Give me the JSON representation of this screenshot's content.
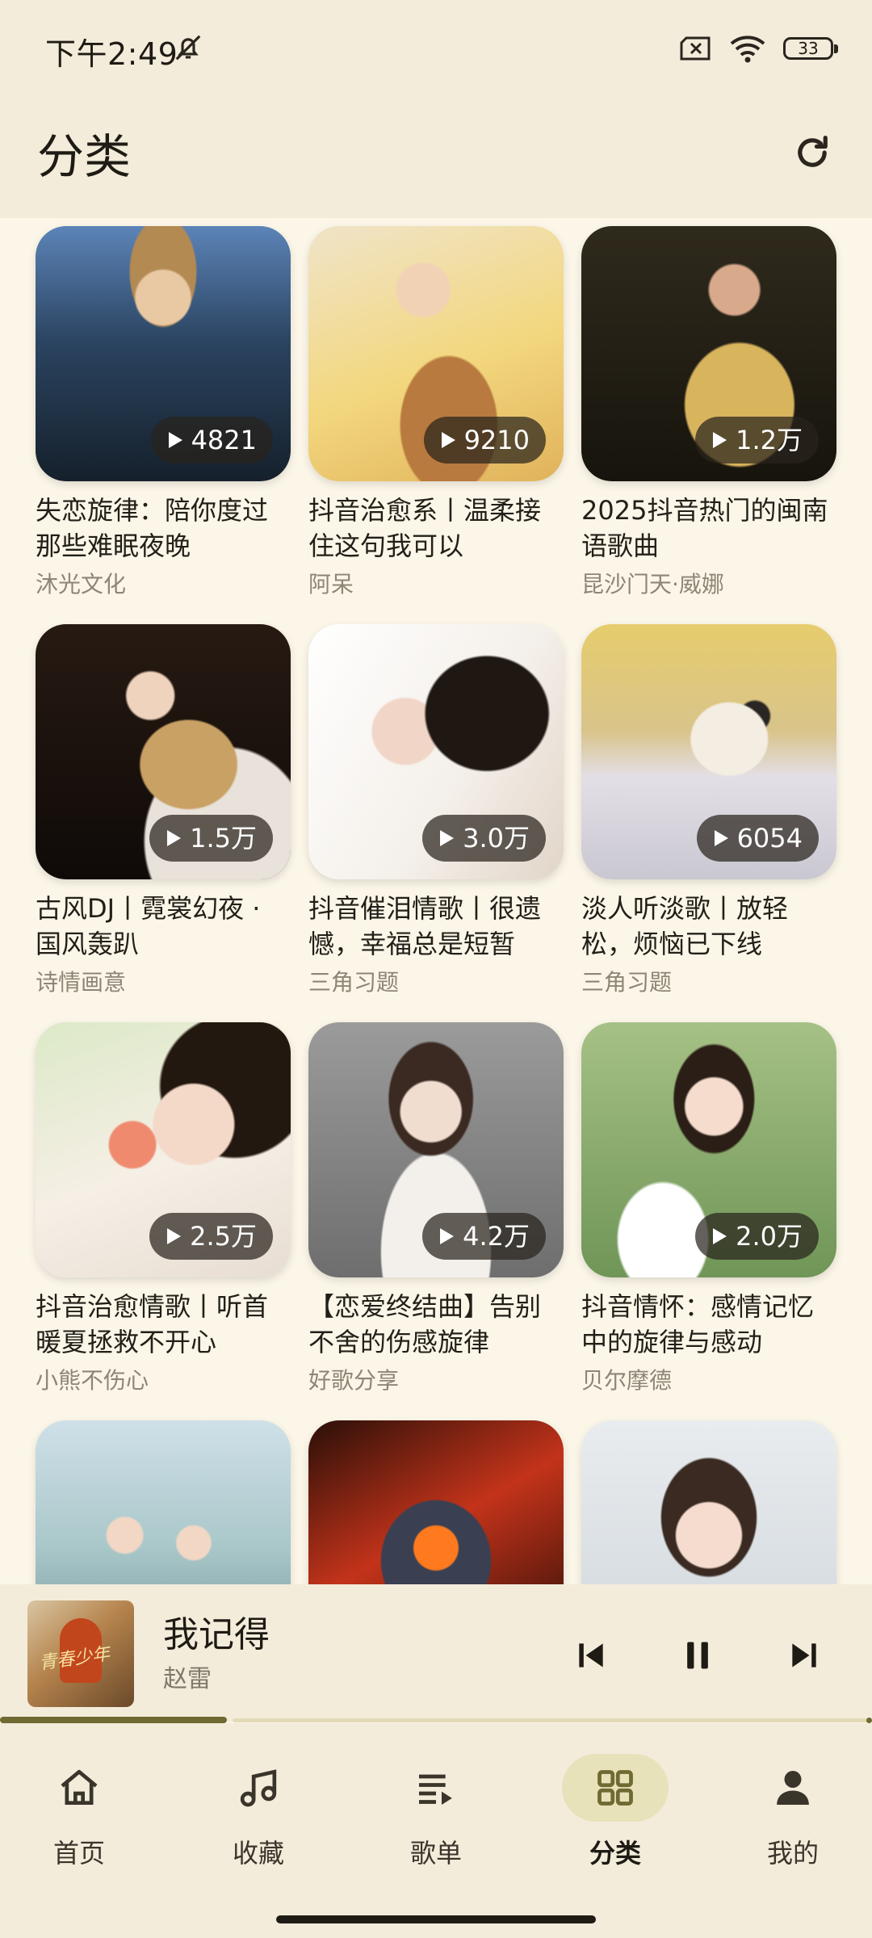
{
  "status": {
    "time": "下午2:49",
    "battery": "33"
  },
  "header": {
    "title": "分类"
  },
  "playlists": [
    {
      "title": "失恋旋律：陪你度过那些难眠夜晚",
      "author": "沐光文化",
      "plays": "4821",
      "art": "night-portrait"
    },
    {
      "title": "抖音治愈系丨温柔接住这句我可以",
      "author": "阿呆",
      "plays": "9210",
      "art": "guitar-girl"
    },
    {
      "title": "2025抖音热门的闽南语歌曲",
      "author": "昆沙门天·威娜",
      "plays": "1.2万",
      "art": "gold-singer"
    },
    {
      "title": "古风DJ丨霓裳幻夜 · 国风轰趴",
      "author": "诗情画意",
      "plays": "1.5万",
      "art": "pipa-dancer"
    },
    {
      "title": "抖音催泪情歌丨很遗憾，幸福总是短暂",
      "author": "三角习题",
      "plays": "3.0万",
      "art": "profile-girl"
    },
    {
      "title": "淡人听淡歌丨放轻松，烦恼已下线",
      "author": "三角习题",
      "plays": "6054",
      "art": "cat-headphones"
    },
    {
      "title": "抖音治愈情歌丨听首暖夏拯救不开心",
      "author": "小熊不伤心",
      "plays": "2.5万",
      "art": "peach-girl"
    },
    {
      "title": "【恋爱终结曲】告别不舍的伤感旋律",
      "author": "好歌分享",
      "plays": "4.2万",
      "art": "grey-portrait"
    },
    {
      "title": "抖音情怀：感情记忆中的旋律与感动",
      "author": "贝尔摩德",
      "plays": "2.0万",
      "art": "braid-girl"
    },
    {
      "title": "",
      "author": "",
      "plays": "",
      "art": "anime-couple"
    },
    {
      "title": "",
      "author": "",
      "plays": "",
      "art": "mecha"
    },
    {
      "title": "",
      "author": "",
      "plays": "",
      "art": "smile-girl"
    }
  ],
  "player": {
    "song": "我记得",
    "artist": "赵雷",
    "progress": 0.26
  },
  "nav": {
    "home": "首页",
    "favorites": "收藏",
    "playlists": "歌单",
    "categories": "分类",
    "mine": "我的"
  },
  "colors": {
    "background": "#fbf6e8",
    "bar": "#f3ecdb",
    "accent": "#6f6a31",
    "active_pill": "#e8e2bb"
  }
}
